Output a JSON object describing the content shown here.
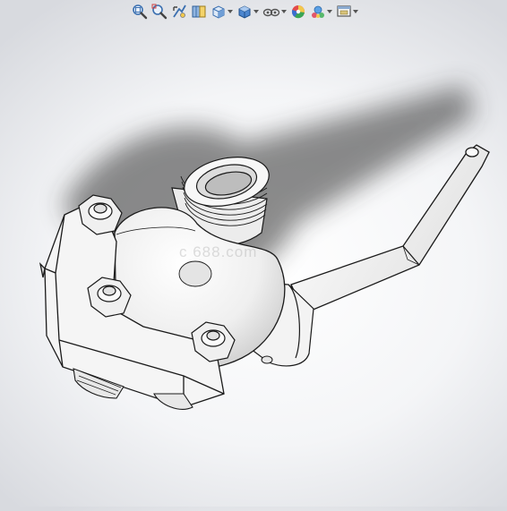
{
  "toolbar": {
    "buttons": [
      {
        "name": "zoom-to-fit",
        "icon": "zoom-to-fit-icon",
        "dropdown": false
      },
      {
        "name": "zoom-to-area",
        "icon": "zoom-to-area-icon",
        "dropdown": false
      },
      {
        "name": "previous-view",
        "icon": "previous-view-icon",
        "dropdown": false
      },
      {
        "name": "section-view",
        "icon": "section-view-icon",
        "dropdown": false
      },
      {
        "name": "view-orientation",
        "icon": "view-orientation-icon",
        "dropdown": true
      },
      {
        "name": "display-style",
        "icon": "display-style-icon",
        "dropdown": true
      },
      {
        "name": "hide-show-items",
        "icon": "hide-show-items-icon",
        "dropdown": true
      },
      {
        "name": "edit-appearance",
        "icon": "edit-appearance-icon",
        "dropdown": false
      },
      {
        "name": "apply-scene",
        "icon": "apply-scene-icon",
        "dropdown": true
      },
      {
        "name": "view-settings",
        "icon": "view-settings-icon",
        "dropdown": true
      }
    ]
  },
  "viewport": {
    "model": "ball-valve-assembly",
    "background_colors": [
      "#ffffff",
      "#d8dadf"
    ],
    "shadow_color": "#3a3a3a",
    "watermark": "c  688.com"
  }
}
